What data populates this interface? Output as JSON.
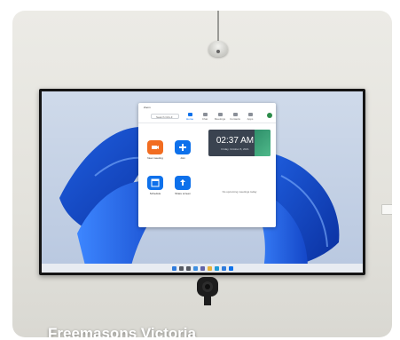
{
  "caption": "Freemasons Victoria",
  "zoom": {
    "title": "Zoom",
    "search_placeholder": "Search  Ctrl+F",
    "tabs": [
      {
        "label": "Home"
      },
      {
        "label": "Chat"
      },
      {
        "label": "Meetings"
      },
      {
        "label": "Contacts"
      },
      {
        "label": "Apps"
      }
    ],
    "actions": [
      {
        "label": "New meeting",
        "color": "#f26d21"
      },
      {
        "label": "Join",
        "color": "#0e71eb"
      },
      {
        "label": "Schedule",
        "color": "#0e71eb"
      },
      {
        "label": "Share screen",
        "color": "#0e71eb"
      }
    ],
    "clock_time": "02:37 AM",
    "clock_date": "Friday, October 8, 2021",
    "empty_meetings": "No upcoming meetings today"
  },
  "taskbar_icons": [
    {
      "name": "start-icon",
      "color": "#2f7bdc"
    },
    {
      "name": "search-icon",
      "color": "#555a63"
    },
    {
      "name": "task-view-icon",
      "color": "#555a63"
    },
    {
      "name": "widgets-icon",
      "color": "#3f8fe0"
    },
    {
      "name": "chat-icon",
      "color": "#6264a7"
    },
    {
      "name": "explorer-icon",
      "color": "#e6b23c"
    },
    {
      "name": "edge-icon",
      "color": "#1e9ad6"
    },
    {
      "name": "store-icon",
      "color": "#2f7bdc"
    },
    {
      "name": "zoom-icon",
      "color": "#0e71eb"
    }
  ]
}
